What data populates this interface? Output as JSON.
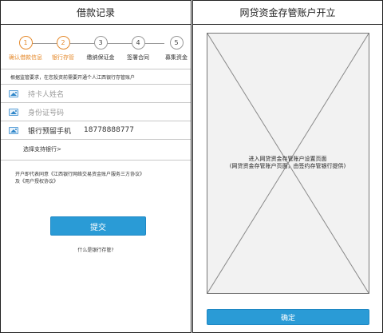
{
  "left": {
    "title": "借款记录",
    "steps": [
      {
        "num": "1",
        "label": "确认借款信息",
        "active": true
      },
      {
        "num": "2",
        "label": "银行存管",
        "active": true
      },
      {
        "num": "3",
        "label": "缴纳保证金",
        "active": false
      },
      {
        "num": "4",
        "label": "签署合同",
        "active": false
      },
      {
        "num": "5",
        "label": "募集资金",
        "active": false
      }
    ],
    "notice": "根据监管要求，在您投资前需要开通个人江西银行存管账户",
    "fields": {
      "name_placeholder": "持卡人姓名",
      "id_placeholder": "身份证号码",
      "phone_label": "银行预留手机",
      "phone_value": "18778888777"
    },
    "bank_link": "选择支持银行>",
    "agreement_line1": "开户即代表同意《江西银行网络交易资金账户服务三方协议》",
    "agreement_line2": "及《用户授权协议》",
    "submit_label": "提交",
    "what_is_link": "什么是银行存管?"
  },
  "right": {
    "title": "网贷资金存管账户开立",
    "placeholder_line1": "进入网贷资金存管账户设置页面",
    "placeholder_line2": "(网贷资金存管账户页面，由签约存管银行提供)",
    "confirm_label": "确定"
  },
  "colors": {
    "accent": "#2a9bd6",
    "active_step": "#e58a2c"
  }
}
